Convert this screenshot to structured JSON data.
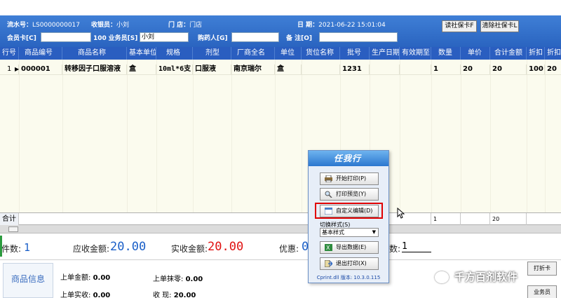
{
  "header": {
    "serial_label": "流水号：",
    "serial_value": "LS0000000017",
    "cashier_label": "收银员：",
    "cashier_value": "小刘",
    "store_label": "门  店：",
    "store_value": "门店",
    "date_label": "日  期：",
    "date_value": "2021-06-22 15:01:04",
    "member_card_label": "会员卡[C]",
    "member_card_value": "",
    "salesman_code": "100",
    "salesman_label": "业务员[S]",
    "salesman_value": "小刘",
    "buyer_label": "购药人[G]",
    "buyer_value": "",
    "remark_label": "备  注[O]",
    "remark_value": "",
    "read_card_button": "读社保卡F",
    "clear_card_button": "清除社保卡L"
  },
  "table": {
    "columns": [
      "行号",
      "商品编号",
      "商品名称",
      "基本单位",
      "规格",
      "剂型",
      "厂商全名",
      "单位",
      "货位名称",
      "批号",
      "生产日期",
      "有效期至",
      "数量",
      "单价",
      "合计金额",
      "折扣",
      "折扣..."
    ],
    "rows": [
      {
        "row_no": "1",
        "code": "000001",
        "name": "转移因子口服溶液",
        "base_unit": "盒",
        "spec": "10ml*6支",
        "form": "口服液",
        "manufacturer": "南京瑞尔",
        "unit": "盒",
        "location": "",
        "batch": "1231",
        "prod_date": "",
        "expiry": "",
        "qty": "1",
        "price": "20",
        "amount": "20",
        "discount": "100",
        "discount2": "20"
      }
    ],
    "totals_label": "合计",
    "totals_qty": "1",
    "totals_amount": "20"
  },
  "summary": {
    "count_label": "件数:",
    "count_value": "1",
    "receivable_label": "应收金额:",
    "receivable_value": "20.00",
    "actual_label": "实收金额:",
    "actual_value": "20.00",
    "discount_label": "优惠:",
    "discount_value": "0",
    "pieces_label": "数:",
    "pieces_value": "1"
  },
  "bottom": {
    "product_info_tab": "商品信息",
    "last_amount_label": "上单金额:",
    "last_amount_value": "0.00",
    "last_rounding_label": "上单抹零:",
    "last_rounding_value": "0.00",
    "last_actual_label": "上单实收:",
    "last_actual_value": "0.00",
    "collect_label": "收    现:",
    "collect_value": "20.00",
    "discount_card_button": "打折卡",
    "salesman_button": "业务员"
  },
  "print_dialog": {
    "logo_text": "任我行",
    "start_print": "开始打印(P)",
    "print_preview": "打印预览(Y)",
    "custom_edit": "自定义编辑(D)",
    "style_label": "切换样式(S)",
    "style_value": "基本样式",
    "export_data": "导出数据(E)",
    "exit_print": "退出打印(X)",
    "version": "Cprint.dll 版本: 10.3.0.115"
  },
  "watermark": "千方百剂软件"
}
